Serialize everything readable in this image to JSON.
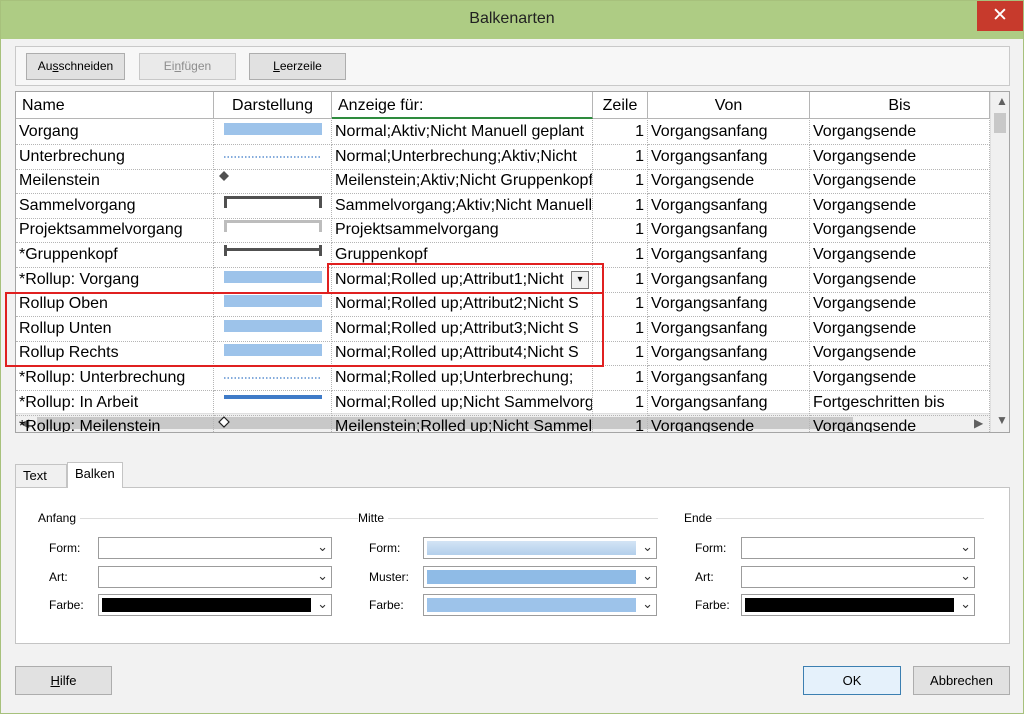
{
  "window": {
    "title": "Balkenarten",
    "close_glyph": "✕"
  },
  "toolbar": {
    "cut_label": "Ausschneiden",
    "paste_label": "Einfügen",
    "blank_row_label": "Leerzeile"
  },
  "table": {
    "columns": [
      "Name",
      "Darstellung",
      "Anzeige für:",
      "Zeile",
      "Von",
      "Bis"
    ],
    "rows": [
      {
        "name": "Vorgang",
        "bar": "bar-light",
        "anzeige": "Normal;Aktiv;Nicht Manuell geplant",
        "zeile": "1",
        "von": "Vorgangsanfang",
        "bis": "Vorgangsende"
      },
      {
        "name": "Unterbrechung",
        "bar": "dotted",
        "anzeige": "Normal;Unterbrechung;Aktiv;Nicht",
        "zeile": "1",
        "von": "Vorgangsanfang",
        "bis": "Vorgangsende"
      },
      {
        "name": "Meilenstein",
        "bar": "diamond",
        "anzeige": "Meilenstein;Aktiv;Nicht Gruppenkopf",
        "zeile": "1",
        "von": "Vorgangsende",
        "bis": "Vorgangsende"
      },
      {
        "name": "Sammelvorgang",
        "bar": "bracket-dark",
        "anzeige": "Sammelvorgang;Aktiv;Nicht Manuell",
        "zeile": "1",
        "von": "Vorgangsanfang",
        "bis": "Vorgangsende"
      },
      {
        "name": "Projektsammelvorgang",
        "bar": "bracket-gray",
        "anzeige": "Projektsammelvorgang",
        "zeile": "1",
        "von": "Vorgangsanfang",
        "bis": "Vorgangsende"
      },
      {
        "name": "*Gruppenkopf",
        "bar": "bracket-line",
        "anzeige": "Gruppenkopf",
        "zeile": "1",
        "von": "Vorgangsanfang",
        "bis": "Vorgangsende"
      },
      {
        "name": "*Rollup: Vorgang",
        "bar": "bar-light",
        "anzeige": "Normal;Rolled up;Attribut1;Nicht",
        "zeile": "1",
        "von": "Vorgangsanfang",
        "bis": "Vorgangsende"
      },
      {
        "name": "Rollup Oben",
        "bar": "bar-light",
        "anzeige": "Normal;Rolled up;Attribut2;Nicht S",
        "zeile": "1",
        "von": "Vorgangsanfang",
        "bis": "Vorgangsende"
      },
      {
        "name": "Rollup Unten",
        "bar": "bar-light",
        "anzeige": "Normal;Rolled up;Attribut3;Nicht S",
        "zeile": "1",
        "von": "Vorgangsanfang",
        "bis": "Vorgangsende"
      },
      {
        "name": "Rollup Rechts",
        "bar": "bar-light",
        "anzeige": "Normal;Rolled up;Attribut4;Nicht S",
        "zeile": "1",
        "von": "Vorgangsanfang",
        "bis": "Vorgangsende"
      },
      {
        "name": "*Rollup: Unterbrechung",
        "bar": "dotted",
        "anzeige": "Normal;Rolled up;Unterbrechung;",
        "zeile": "1",
        "von": "Vorgangsanfang",
        "bis": "Vorgangsende"
      },
      {
        "name": "*Rollup: In Arbeit",
        "bar": "bar-thin-blue",
        "anzeige": "Normal;Rolled up;Nicht Sammelvorgang",
        "zeile": "1",
        "von": "Vorgangsanfang",
        "bis": "Fortgeschritten bis"
      },
      {
        "name": "*Rollup: Meilenstein",
        "bar": "diamond-outline",
        "anzeige": "Meilenstein;Rolled up;Nicht Sammelvorgang",
        "zeile": "1",
        "von": "Vorgangsende",
        "bis": "Vorgangsende"
      }
    ]
  },
  "tabs": [
    "Text",
    "Balken"
  ],
  "panel": {
    "groups": [
      {
        "title": "Anfang",
        "labels": [
          "Form:",
          "Art:",
          "Farbe:"
        ],
        "colors": [
          "",
          "",
          "#000000"
        ]
      },
      {
        "title": "Mitte",
        "labels": [
          "Form:",
          "Muster:",
          "Farbe:"
        ],
        "colors": [
          "#b9d3ee",
          "#8fbbe6",
          "#9dc3ea"
        ]
      },
      {
        "title": "Ende",
        "labels": [
          "Form:",
          "Art:",
          "Farbe:"
        ],
        "colors": [
          "",
          "",
          "#000000"
        ]
      }
    ]
  },
  "footer": {
    "help_label": "Hilfe",
    "ok_label": "OK",
    "cancel_label": "Abbrechen"
  }
}
